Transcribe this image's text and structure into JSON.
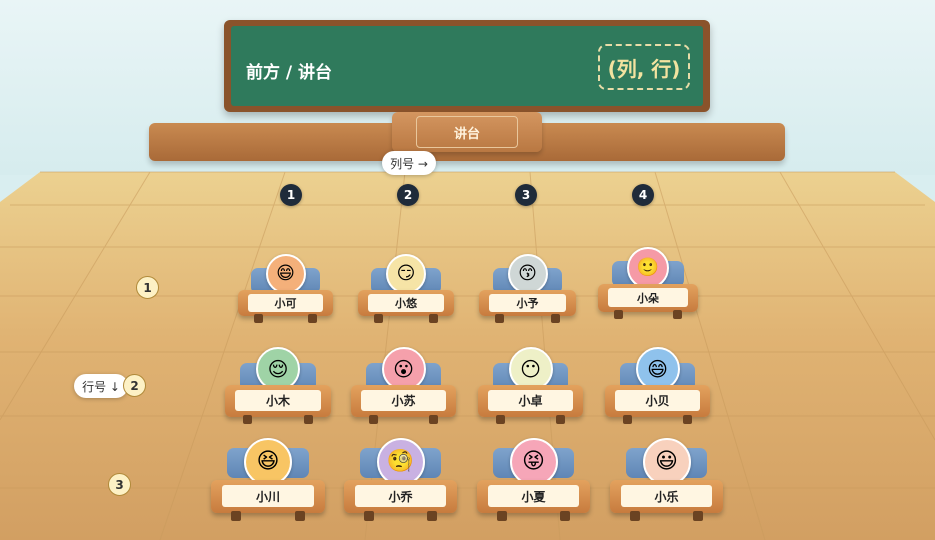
{
  "board": {
    "title": "前方 / 讲台",
    "coord_label": "(列, 行)"
  },
  "podium": {
    "label": "讲台"
  },
  "axes": {
    "column_label": "列号 →",
    "row_label": "行号 ↓"
  },
  "columns": [
    "1",
    "2",
    "3",
    "4"
  ],
  "rows": [
    "1",
    "2",
    "3"
  ],
  "students": [
    {
      "name": "小可",
      "emoji": "😄",
      "avatar_color": "#f4b07a",
      "col": 1,
      "row": 1
    },
    {
      "name": "小悠",
      "emoji": "😏",
      "avatar_color": "#f6e4a6",
      "col": 2,
      "row": 1
    },
    {
      "name": "小予",
      "emoji": "😙",
      "avatar_color": "#cfd7d6",
      "col": 3,
      "row": 1
    },
    {
      "name": "小朵",
      "emoji": "🙂",
      "avatar_color": "#f59aa6",
      "col": 4,
      "row": 1
    },
    {
      "name": "小木",
      "emoji": "😌",
      "avatar_color": "#9fd3a6",
      "col": 1,
      "row": 2
    },
    {
      "name": "小苏",
      "emoji": "😮",
      "avatar_color": "#f5a0ab",
      "col": 2,
      "row": 2
    },
    {
      "name": "小卓",
      "emoji": "😶",
      "avatar_color": "#eef0c7",
      "col": 3,
      "row": 2
    },
    {
      "name": "小贝",
      "emoji": "😄",
      "avatar_color": "#8fc2ec",
      "col": 4,
      "row": 2
    },
    {
      "name": "小川",
      "emoji": "😆",
      "avatar_color": "#f8c564",
      "col": 1,
      "row": 3
    },
    {
      "name": "小乔",
      "emoji": "🧐",
      "avatar_color": "#c9b1e2",
      "col": 2,
      "row": 3
    },
    {
      "name": "小夏",
      "emoji": "😝",
      "avatar_color": "#f6a6b8",
      "col": 3,
      "row": 3
    },
    {
      "name": "小乐",
      "emoji": "😃",
      "avatar_color": "#f8d1bd",
      "col": 4,
      "row": 3
    }
  ]
}
